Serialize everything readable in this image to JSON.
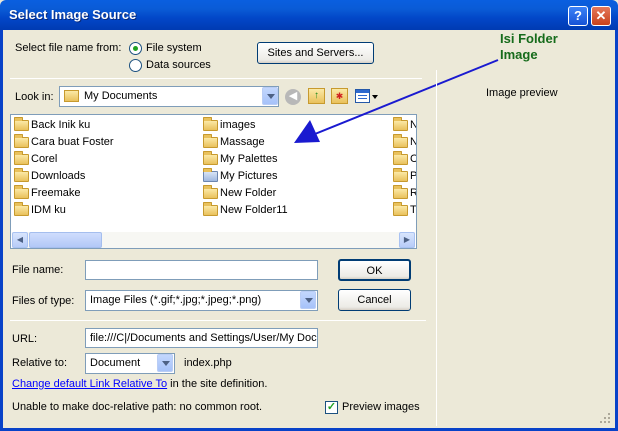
{
  "window": {
    "title": "Select Image Source",
    "help_glyph": "?",
    "close_glyph": "✕"
  },
  "source": {
    "label": "Select file name from:",
    "options": [
      "File system",
      "Data sources"
    ],
    "selected": "File system",
    "sites_button": "Sites and Servers..."
  },
  "annotation": {
    "line1": "Isi Folder",
    "line2": "Image",
    "arrow_color": "#1A1AD0"
  },
  "lookin": {
    "label": "Look in:",
    "value": "My Documents"
  },
  "files": [
    [
      "Back Inik ku",
      "Cara buat Foster",
      "Corel",
      "Downloads",
      "Freemake",
      "IDM ku"
    ],
    [
      "images",
      "Massage",
      "My Palettes",
      "My Pictures",
      "New Folder",
      "New Folder11"
    ],
    [
      "N",
      "N",
      "C",
      "P",
      "R",
      "T"
    ]
  ],
  "form": {
    "file_name_label": "File name:",
    "file_name_value": "",
    "ok_label": "OK",
    "files_type_label": "Files of type:",
    "files_type_value": "Image Files (*.gif;*.jpg;*.jpeg;*.png)",
    "cancel_label": "Cancel",
    "url_label": "URL:",
    "url_value": "file:///C|/Documents and Settings/User/My Doc",
    "relative_label": "Relative to:",
    "relative_value": "Document",
    "relative_file": "index.php",
    "change_link": "Change default Link Relative To",
    "change_suffix": " in the site definition.",
    "status": "Unable to make doc-relative path: no common root.",
    "preview_label": "Preview images",
    "preview_checked": true
  },
  "preview": {
    "title": "Image preview"
  }
}
